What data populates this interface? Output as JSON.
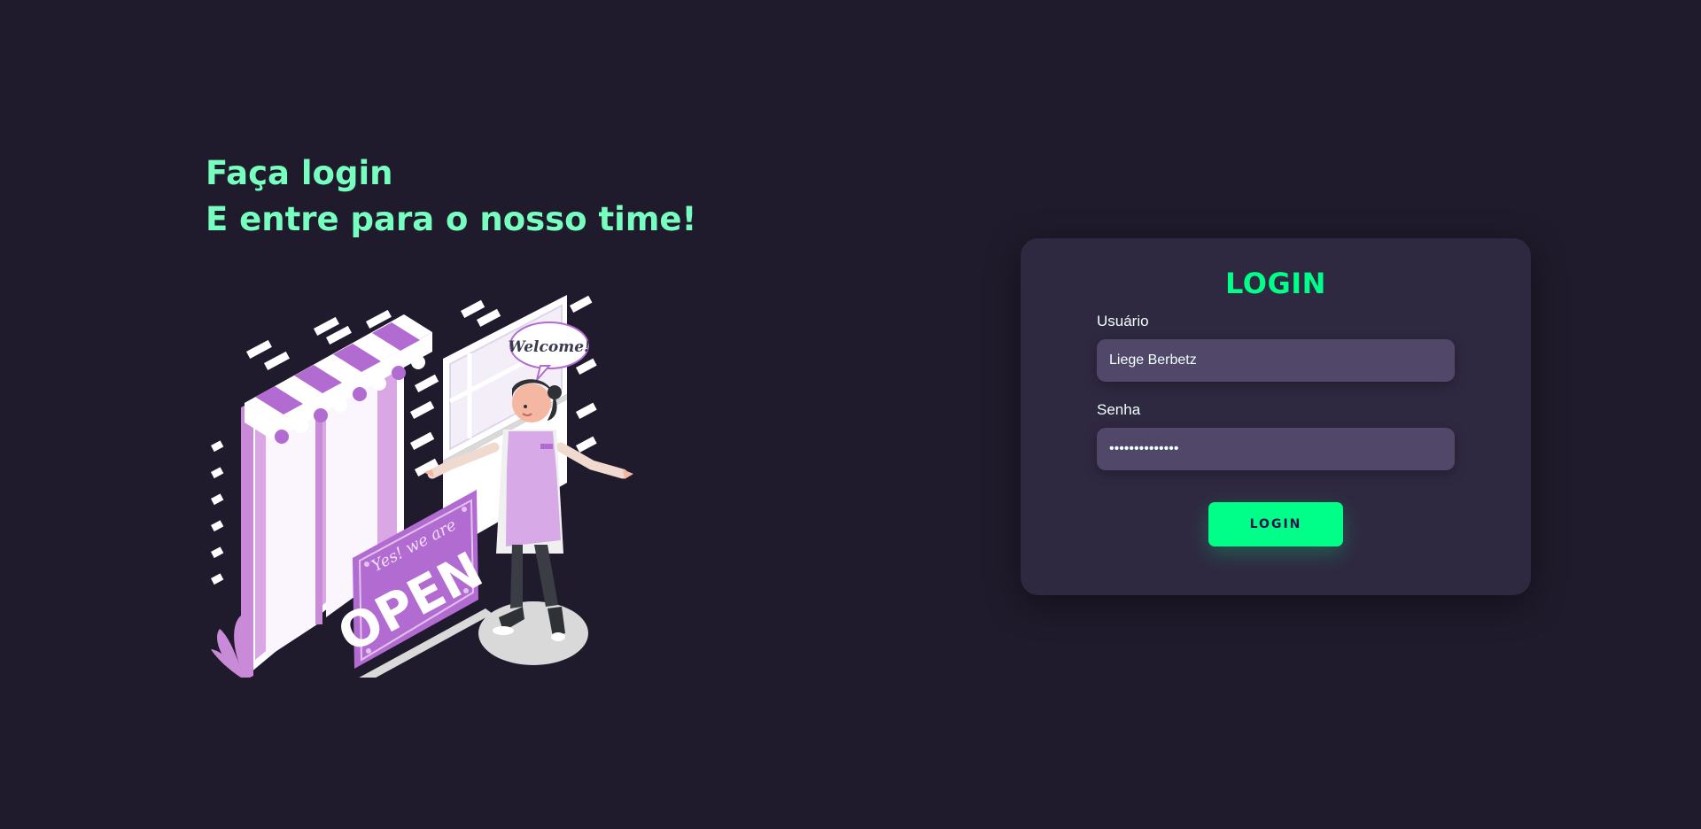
{
  "hero": {
    "line1": "Faça login",
    "line2": "E entre para o nosso time!"
  },
  "illustration": {
    "speech_bubble": "Welcome!",
    "sign_small": "Yes! we are",
    "sign_large": "OPEN"
  },
  "login_card": {
    "title": "LOGIN",
    "username": {
      "label": "Usuário",
      "value": "Liege Berbetz",
      "placeholder": "Usuário"
    },
    "password": {
      "label": "Senha",
      "value": "••••••••••••••",
      "placeholder": "Senha"
    },
    "button_label": "LOGIN"
  },
  "colors": {
    "background": "#201b2c",
    "card": "#2f2841",
    "input": "#514869",
    "accent": "#00ff88",
    "headline": "#77ffc0",
    "illustration_purple": "#b16bd1"
  }
}
